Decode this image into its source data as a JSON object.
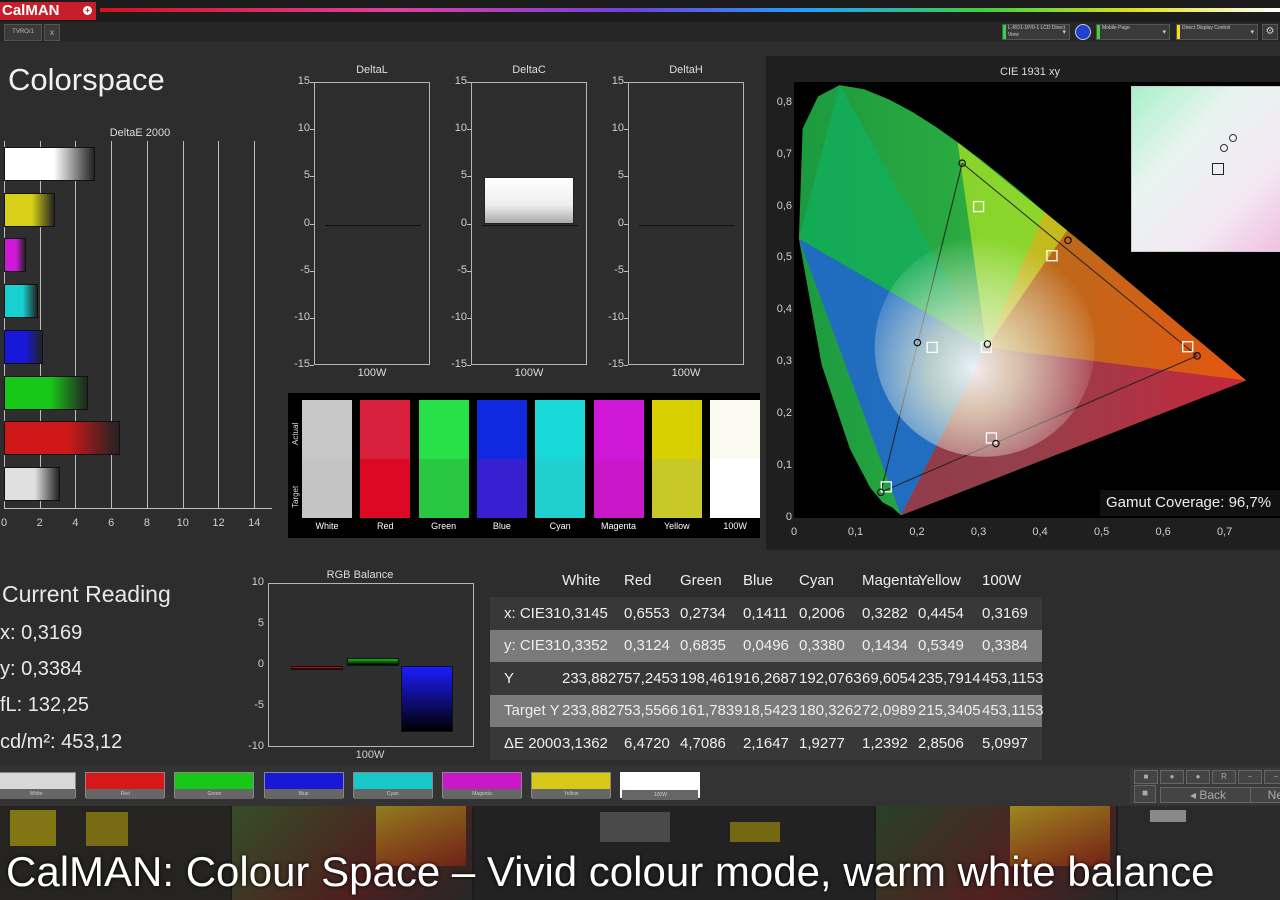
{
  "app": {
    "logo_text": "CalMAN",
    "logo_badge": "+",
    "tab_label": "TVRO/1",
    "tab_close": "x"
  },
  "toolbar": {
    "dropdowns": [
      {
        "label": "L-RO1-1P/0-1 LCD Direct View",
        "color": "#3cd03c"
      },
      {
        "label": "Mobile Page",
        "color": "#3cd03c"
      },
      {
        "label": "Direct Display Control",
        "color": "#f0e020"
      }
    ]
  },
  "page": {
    "title": "Colorspace"
  },
  "deltae": {
    "title": "DeltaE 2000",
    "ticks": [
      "0",
      "2",
      "4",
      "6",
      "8",
      "10",
      "12",
      "14"
    ],
    "bars": [
      {
        "name": "100W",
        "value": 5.0997,
        "color": "#ffffff"
      },
      {
        "name": "Yellow",
        "value": 2.8506,
        "color": "#d8d018"
      },
      {
        "name": "Magenta",
        "value": 1.2392,
        "color": "#d018d8"
      },
      {
        "name": "Cyan",
        "value": 1.9277,
        "color": "#18d0d0"
      },
      {
        "name": "Blue",
        "value": 2.1647,
        "color": "#1818d8"
      },
      {
        "name": "Green",
        "value": 4.7086,
        "color": "#18c818"
      },
      {
        "name": "Red",
        "value": 6.472,
        "color": "#d01818"
      },
      {
        "name": "White",
        "value": 3.1362,
        "color": "#e0e0e0"
      }
    ]
  },
  "delta_charts": [
    {
      "title": "DeltaL",
      "xlabel": "100W",
      "value": 0
    },
    {
      "title": "DeltaC",
      "xlabel": "100W",
      "value": 5
    },
    {
      "title": "DeltaH",
      "xlabel": "100W",
      "value": 0
    }
  ],
  "delta_ticks": [
    "15",
    "10",
    "5",
    "0",
    "-5",
    "-10",
    "-15"
  ],
  "swatches": {
    "actual_label": "Actual",
    "target_label": "Target",
    "items": [
      {
        "label": "White",
        "actual": "#c8c8c8",
        "target": "#c4c4c4"
      },
      {
        "label": "Red",
        "actual": "#d8203c",
        "target": "#dc0824"
      },
      {
        "label": "Green",
        "actual": "#28e048",
        "target": "#28c840"
      },
      {
        "label": "Blue",
        "actual": "#1028e0",
        "target": "#3820d0"
      },
      {
        "label": "Cyan",
        "actual": "#18d8d8",
        "target": "#20d0d0"
      },
      {
        "label": "Magenta",
        "actual": "#d018d8",
        "target": "#c818c8"
      },
      {
        "label": "Yellow",
        "actual": "#d8d000",
        "target": "#c8c828"
      },
      {
        "label": "100W",
        "actual": "#fafaf0",
        "target": "#ffffff"
      }
    ]
  },
  "current_reading": {
    "title": "Current Reading",
    "x": "x: 0,3169",
    "y": "y: 0,3384",
    "fl": "fL: 132,25",
    "cdm2": "cd/m²: 453,12"
  },
  "rgb_balance": {
    "title": "RGB Balance",
    "xlabel": "100W",
    "ticks": [
      "10",
      "5",
      "0",
      "-5",
      "-10"
    ],
    "values": [
      {
        "name": "Red",
        "value": -0.5,
        "color": "#e01818"
      },
      {
        "name": "Green",
        "value": 1.0,
        "color": "#18b818"
      },
      {
        "name": "Blue",
        "value": -8.0,
        "color": "#1c1cff"
      }
    ]
  },
  "table": {
    "columns": [
      "",
      "White",
      "Red",
      "Green",
      "Blue",
      "Cyan",
      "Magenta",
      "Yellow",
      "100W"
    ],
    "rows": [
      [
        "x: CIE31",
        "0,3145",
        "0,6553",
        "0,2734",
        "0,1411",
        "0,2006",
        "0,3282",
        "0,4454",
        "0,3169"
      ],
      [
        "y: CIE31",
        "0,3352",
        "0,3124",
        "0,6835",
        "0,0496",
        "0,3380",
        "0,1434",
        "0,5349",
        "0,3384"
      ],
      [
        "Y",
        "233,8827",
        "57,2453",
        "198,4619",
        "16,2687",
        "192,0763",
        "69,6054",
        "235,7914",
        "453,1153"
      ],
      [
        "Target Y",
        "233,8827",
        "53,5566",
        "161,7839",
        "18,5423",
        "180,3262",
        "72,0989",
        "215,3405",
        "453,1153"
      ],
      [
        "ΔE 2000",
        "3,1362",
        "6,4720",
        "4,7086",
        "2,1647",
        "1,9277",
        "1,2392",
        "2,8506",
        "5,0997"
      ]
    ]
  },
  "cie": {
    "title": "CIE 1931 xy",
    "gamut_label": "Gamut Coverage:",
    "gamut_value": "96,7%",
    "x_ticks": [
      "0",
      "0,1",
      "0,2",
      "0,3",
      "0,4",
      "0,5",
      "0,6",
      "0,7"
    ],
    "y_ticks": [
      "0,8",
      "0,7",
      "0,6",
      "0,5",
      "0,4",
      "0,3",
      "0,2",
      "0,1",
      "0"
    ],
    "targets": [
      [
        0.64,
        0.33
      ],
      [
        0.3,
        0.6
      ],
      [
        0.15,
        0.06
      ],
      [
        0.3127,
        0.329
      ],
      [
        0.2246,
        0.3287
      ],
      [
        0.3209,
        0.1542
      ],
      [
        0.4193,
        0.5053
      ]
    ],
    "measured": [
      [
        0.6553,
        0.3124
      ],
      [
        0.2734,
        0.6835
      ],
      [
        0.1411,
        0.0496
      ],
      [
        0.3145,
        0.3352
      ],
      [
        0.2006,
        0.338
      ],
      [
        0.3282,
        0.1434
      ],
      [
        0.4454,
        0.5349
      ]
    ]
  },
  "bottom_swatches": [
    {
      "label": "White",
      "color": "#d8d8d8"
    },
    {
      "label": "Red",
      "color": "#d81818"
    },
    {
      "label": "Green",
      "color": "#18c818"
    },
    {
      "label": "Blue",
      "color": "#1818d8"
    },
    {
      "label": "Cyan",
      "color": "#18c8c8"
    },
    {
      "label": "Magenta",
      "color": "#c818c8"
    },
    {
      "label": "Yellow",
      "color": "#d8c818"
    },
    {
      "label": "100W",
      "color": "#ffffff"
    }
  ],
  "nav": {
    "back": "Back",
    "next": "Next"
  },
  "caption": "CalMAN: Colour Space – Vivid colour mode, warm white balance"
}
